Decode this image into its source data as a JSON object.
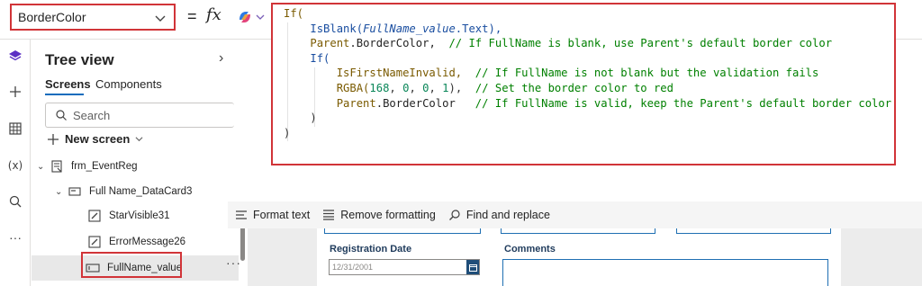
{
  "property_selector": {
    "value": "BorderColor"
  },
  "formula_bar": {
    "equals": "=",
    "fx": "fx"
  },
  "code_lines": [
    [
      {
        "t": "If(",
        "c": "k-ctrl"
      }
    ],
    [
      {
        "t": "    ",
        "c": "k-p"
      },
      {
        "t": "IsBlank(",
        "c": "k-fn"
      },
      {
        "t": "FullName_value",
        "c": "k-var"
      },
      {
        "t": ".Text),",
        "c": "k-fn"
      }
    ],
    [
      {
        "t": "    ",
        "c": "k-p"
      },
      {
        "t": "Parent",
        "c": "k-ctrl"
      },
      {
        "t": ".BorderColor,  ",
        "c": "k-prop"
      },
      {
        "t": "// If FullName is blank, use Parent's default border color",
        "c": "k-com"
      }
    ],
    [
      {
        "t": "    ",
        "c": "k-p"
      },
      {
        "t": "If(",
        "c": "k-fn"
      }
    ],
    [
      {
        "t": "        ",
        "c": "k-p"
      },
      {
        "t": "IsFirstNameInvalid,  ",
        "c": "k-ctrl"
      },
      {
        "t": "// If FullName is not blank but the validation fails",
        "c": "k-com"
      }
    ],
    [
      {
        "t": "        ",
        "c": "k-p"
      },
      {
        "t": "RGBA(",
        "c": "k-ctrl"
      },
      {
        "t": "168",
        "c": "k-num"
      },
      {
        "t": ", ",
        "c": "k-p"
      },
      {
        "t": "0",
        "c": "k-num"
      },
      {
        "t": ", ",
        "c": "k-p"
      },
      {
        "t": "0",
        "c": "k-num"
      },
      {
        "t": ", ",
        "c": "k-p"
      },
      {
        "t": "1",
        "c": "k-num"
      },
      {
        "t": "),  ",
        "c": "k-p"
      },
      {
        "t": "// Set the border color to red",
        "c": "k-com"
      }
    ],
    [
      {
        "t": "        ",
        "c": "k-p"
      },
      {
        "t": "Parent",
        "c": "k-ctrl"
      },
      {
        "t": ".BorderColor   ",
        "c": "k-prop"
      },
      {
        "t": "// If FullName is valid, keep the Parent's default border color",
        "c": "k-com"
      }
    ],
    [
      {
        "t": "    )",
        "c": "k-p"
      }
    ],
    [
      {
        "t": ")",
        "c": "k-p"
      }
    ]
  ],
  "tree": {
    "title": "Tree view",
    "tabs": [
      "Screens",
      "Components"
    ],
    "search_placeholder": "Search",
    "new_screen_label": "New screen",
    "items": [
      {
        "label": "frm_EventReg",
        "icon": "form-icon"
      },
      {
        "label": "Full Name_DataCard3",
        "icon": "datacard-icon"
      },
      {
        "label": "StarVisible31",
        "icon": "edit-label-icon"
      },
      {
        "label": "ErrorMessage26",
        "icon": "edit-label-icon"
      },
      {
        "label": "FullName_value",
        "icon": "text-input-icon"
      }
    ]
  },
  "format_toolbar": {
    "format_text": "Format text",
    "remove_formatting": "Remove formatting",
    "find_replace": "Find and replace"
  },
  "form": {
    "registration_date_label": "Registration Date",
    "registration_date_value": "12/31/2001",
    "comments_label": "Comments"
  },
  "colors": {
    "highlight_border": "#d13438",
    "accent": "#0f6cbd",
    "comment": "#008000",
    "number": "#098658"
  }
}
